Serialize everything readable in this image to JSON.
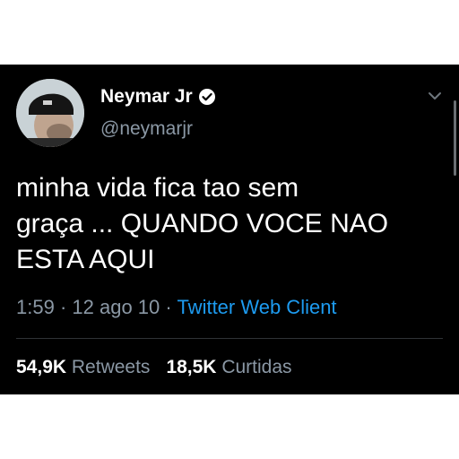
{
  "tweet": {
    "author_name": "Neymar Jr",
    "author_handle": "@neymarjr",
    "verified_icon": "verified-badge-icon",
    "menu_icon": "chevron-down-icon",
    "text_line1": "minha vida fica tao sem",
    "text_line2": "graça ... QUANDO VOCE NAO",
    "text_line3": "ESTA AQUI",
    "time": "1:59",
    "date": "12 ago 10",
    "separator": "·",
    "client": "Twitter Web Client",
    "retweets_count": "54,9K",
    "retweets_label": "Retweets",
    "likes_count": "18,5K",
    "likes_label": "Curtidas"
  },
  "colors": {
    "background": "#000000",
    "text": "#ffffff",
    "secondary": "#8b98a5",
    "link": "#1d9bf0"
  }
}
